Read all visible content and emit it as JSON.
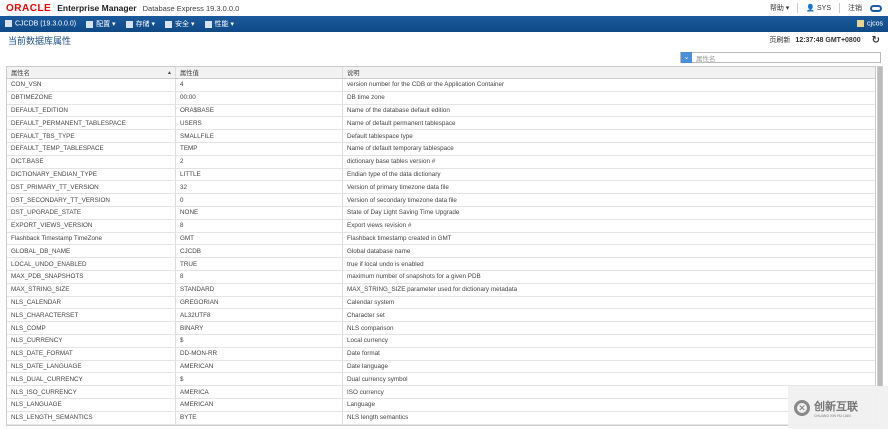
{
  "header": {
    "logo": "ORACLE",
    "product": "Enterprise Manager",
    "edition": "Database Express 19.3.0.0.0",
    "help": "帮助",
    "user": "SYS",
    "logout": "注销"
  },
  "nav": {
    "db": "CJCDB (19.3.0.0.0)",
    "menus": [
      "配置",
      "存储",
      "安全",
      "性能"
    ],
    "container": "cjcos"
  },
  "page": {
    "title": "当前数据库属性",
    "refresh_label": "页刷新",
    "refresh_time": "12:37:48 GMT+0800",
    "search_placeholder": "属性名"
  },
  "table": {
    "headers": [
      "属性名",
      "属性值",
      "说明"
    ],
    "rows": [
      [
        "CON_VSN",
        "4",
        "version number for the CDB or the Application Container"
      ],
      [
        "DBTIMEZONE",
        "00:00",
        "DB time zone"
      ],
      [
        "DEFAULT_EDITION",
        "ORA$BASE",
        "Name of the database default edition"
      ],
      [
        "DEFAULT_PERMANENT_TABLESPACE",
        "USERS",
        "Name of default permanent tablespace"
      ],
      [
        "DEFAULT_TBS_TYPE",
        "SMALLFILE",
        "Default tablespace type"
      ],
      [
        "DEFAULT_TEMP_TABLESPACE",
        "TEMP",
        "Name of default temporary tablespace"
      ],
      [
        "DICT.BASE",
        "2",
        "dictionary base tables version #"
      ],
      [
        "DICTIONARY_ENDIAN_TYPE",
        "LITTLE",
        "Endian type of the data dictionary"
      ],
      [
        "DST_PRIMARY_TT_VERSION",
        "32",
        "Version of primary timezone data file"
      ],
      [
        "DST_SECONDARY_TT_VERSION",
        "0",
        "Version of secondary timezone data file"
      ],
      [
        "DST_UPGRADE_STATE",
        "NONE",
        "State of Day Light Saving Time Upgrade"
      ],
      [
        "EXPORT_VIEWS_VERSION",
        "8",
        "Export views revision #"
      ],
      [
        "Flashback Timestamp TimeZone",
        "GMT",
        "Flashback timestamp created in GMT"
      ],
      [
        "GLOBAL_DB_NAME",
        "CJCDB",
        "Global database name"
      ],
      [
        "LOCAL_UNDO_ENABLED",
        "TRUE",
        "true if local undo is enabled"
      ],
      [
        "MAX_PDB_SNAPSHOTS",
        "8",
        "maximum number of snapshots for a given PDB"
      ],
      [
        "MAX_STRING_SIZE",
        "STANDARD",
        "MAX_STRING_SIZE parameter used for dictionary metadata"
      ],
      [
        "NLS_CALENDAR",
        "GREGORIAN",
        "Calendar system"
      ],
      [
        "NLS_CHARACTERSET",
        "AL32UTF8",
        "Character set"
      ],
      [
        "NLS_COMP",
        "BINARY",
        "NLS comparison"
      ],
      [
        "NLS_CURRENCY",
        "$",
        "Local currency"
      ],
      [
        "NLS_DATE_FORMAT",
        "DD-MON-RR",
        "Date format"
      ],
      [
        "NLS_DATE_LANGUAGE",
        "AMERICAN",
        "Date language"
      ],
      [
        "NLS_DUAL_CURRENCY",
        "$",
        "Dual currency symbol"
      ],
      [
        "NLS_ISO_CURRENCY",
        "AMERICA",
        "ISO currency"
      ],
      [
        "NLS_LANGUAGE",
        "AMERICAN",
        "Language"
      ],
      [
        "NLS_LENGTH_SEMANTICS",
        "BYTE",
        "NLS length semantics"
      ]
    ]
  },
  "watermark": {
    "text": "创新互联",
    "pinyin": "CHUANG XIN HU LIAN"
  }
}
